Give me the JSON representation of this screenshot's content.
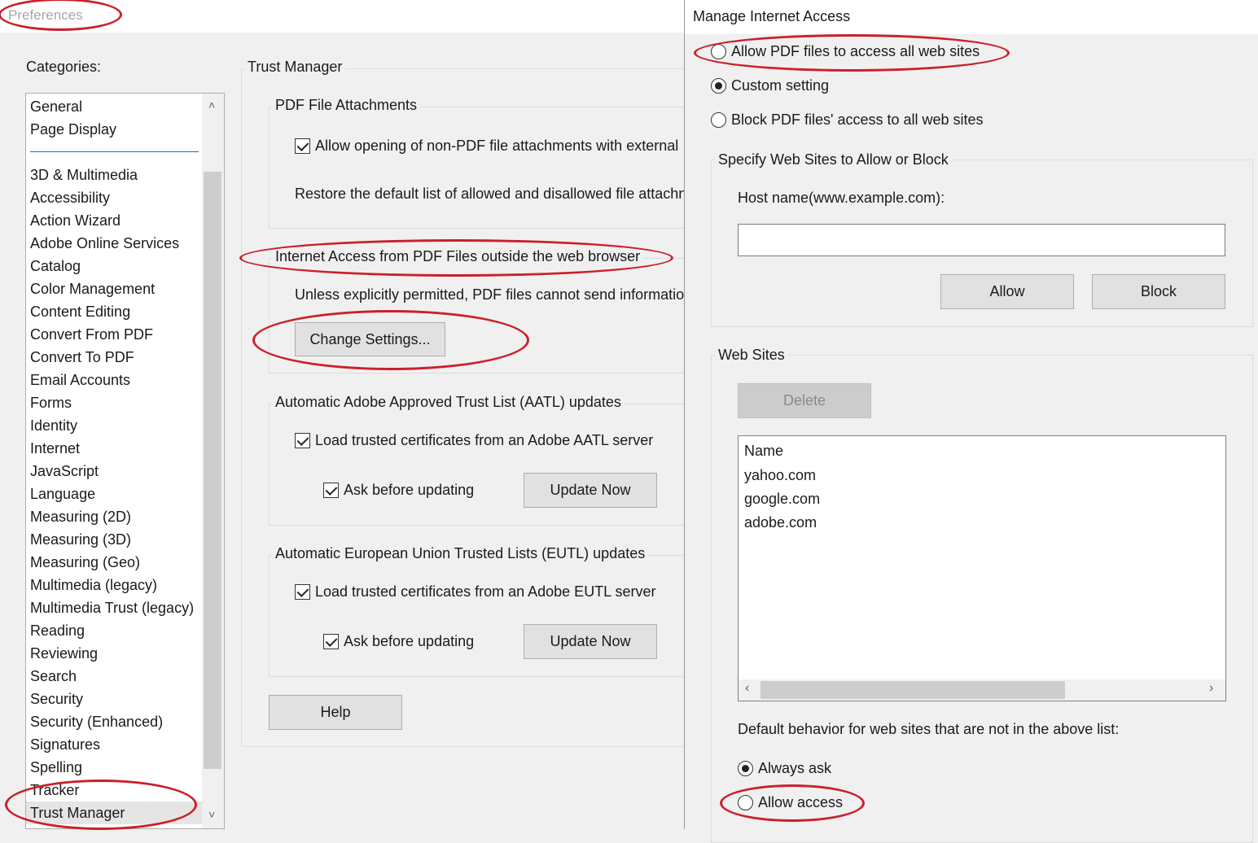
{
  "window": {
    "title": "Preferences"
  },
  "categories": {
    "label": "Categories:",
    "top_items": [
      "General",
      "Page Display"
    ],
    "items": [
      "3D & Multimedia",
      "Accessibility",
      "Action Wizard",
      "Adobe Online Services",
      "Catalog",
      "Color Management",
      "Content Editing",
      "Convert From PDF",
      "Convert To PDF",
      "Email Accounts",
      "Forms",
      "Identity",
      "Internet",
      "JavaScript",
      "Language",
      "Measuring (2D)",
      "Measuring (3D)",
      "Measuring (Geo)",
      "Multimedia (legacy)",
      "Multimedia Trust (legacy)",
      "Reading",
      "Reviewing",
      "Search",
      "Security",
      "Security (Enhanced)",
      "Signatures",
      "Spelling",
      "Tracker",
      "Trust Manager"
    ],
    "selected": "Trust Manager"
  },
  "trust_manager": {
    "title": "Trust Manager",
    "attachments": {
      "legend": "PDF File Attachments",
      "allow_label": "Allow opening of non-PDF file attachments with external",
      "allow_checked": true,
      "restore_text": "Restore the default list of allowed and disallowed file attachn"
    },
    "internet": {
      "legend": "Internet Access from PDF Files outside the web browser",
      "text": "Unless explicitly permitted, PDF files cannot send information",
      "change_button": "Change Settings..."
    },
    "aatl": {
      "legend": "Automatic Adobe Approved Trust List (AATL) updates",
      "load_label": "Load trusted certificates from an Adobe AATL server",
      "ask_label": "Ask before updating",
      "update_button": "Update Now"
    },
    "eutl": {
      "legend": "Automatic European Union Trusted Lists (EUTL) updates",
      "load_label": "Load trusted certificates from an Adobe EUTL server",
      "ask_label": "Ask before updating",
      "update_button": "Update Now"
    },
    "help_button": "Help"
  },
  "manage_internet": {
    "title": "Manage Internet Access",
    "options": [
      "Allow PDF files to access all web sites",
      "Custom setting",
      "Block PDF files' access to all web sites"
    ],
    "selected_option": "Custom setting",
    "specify": {
      "legend": "Specify Web Sites to Allow or Block",
      "host_label": "Host name(www.example.com):",
      "host_value": "",
      "allow_button": "Allow",
      "block_button": "Block"
    },
    "web_sites": {
      "legend": "Web Sites",
      "delete_button": "Delete",
      "column_header": "Name",
      "sites": [
        "yahoo.com",
        "google.com",
        "adobe.com"
      ]
    },
    "default_label": "Default behavior for web sites that are not in the above list:",
    "default_options": [
      "Always ask",
      "Allow access"
    ],
    "default_selected": "Always ask"
  },
  "annotation_color": "#cc1f2b"
}
